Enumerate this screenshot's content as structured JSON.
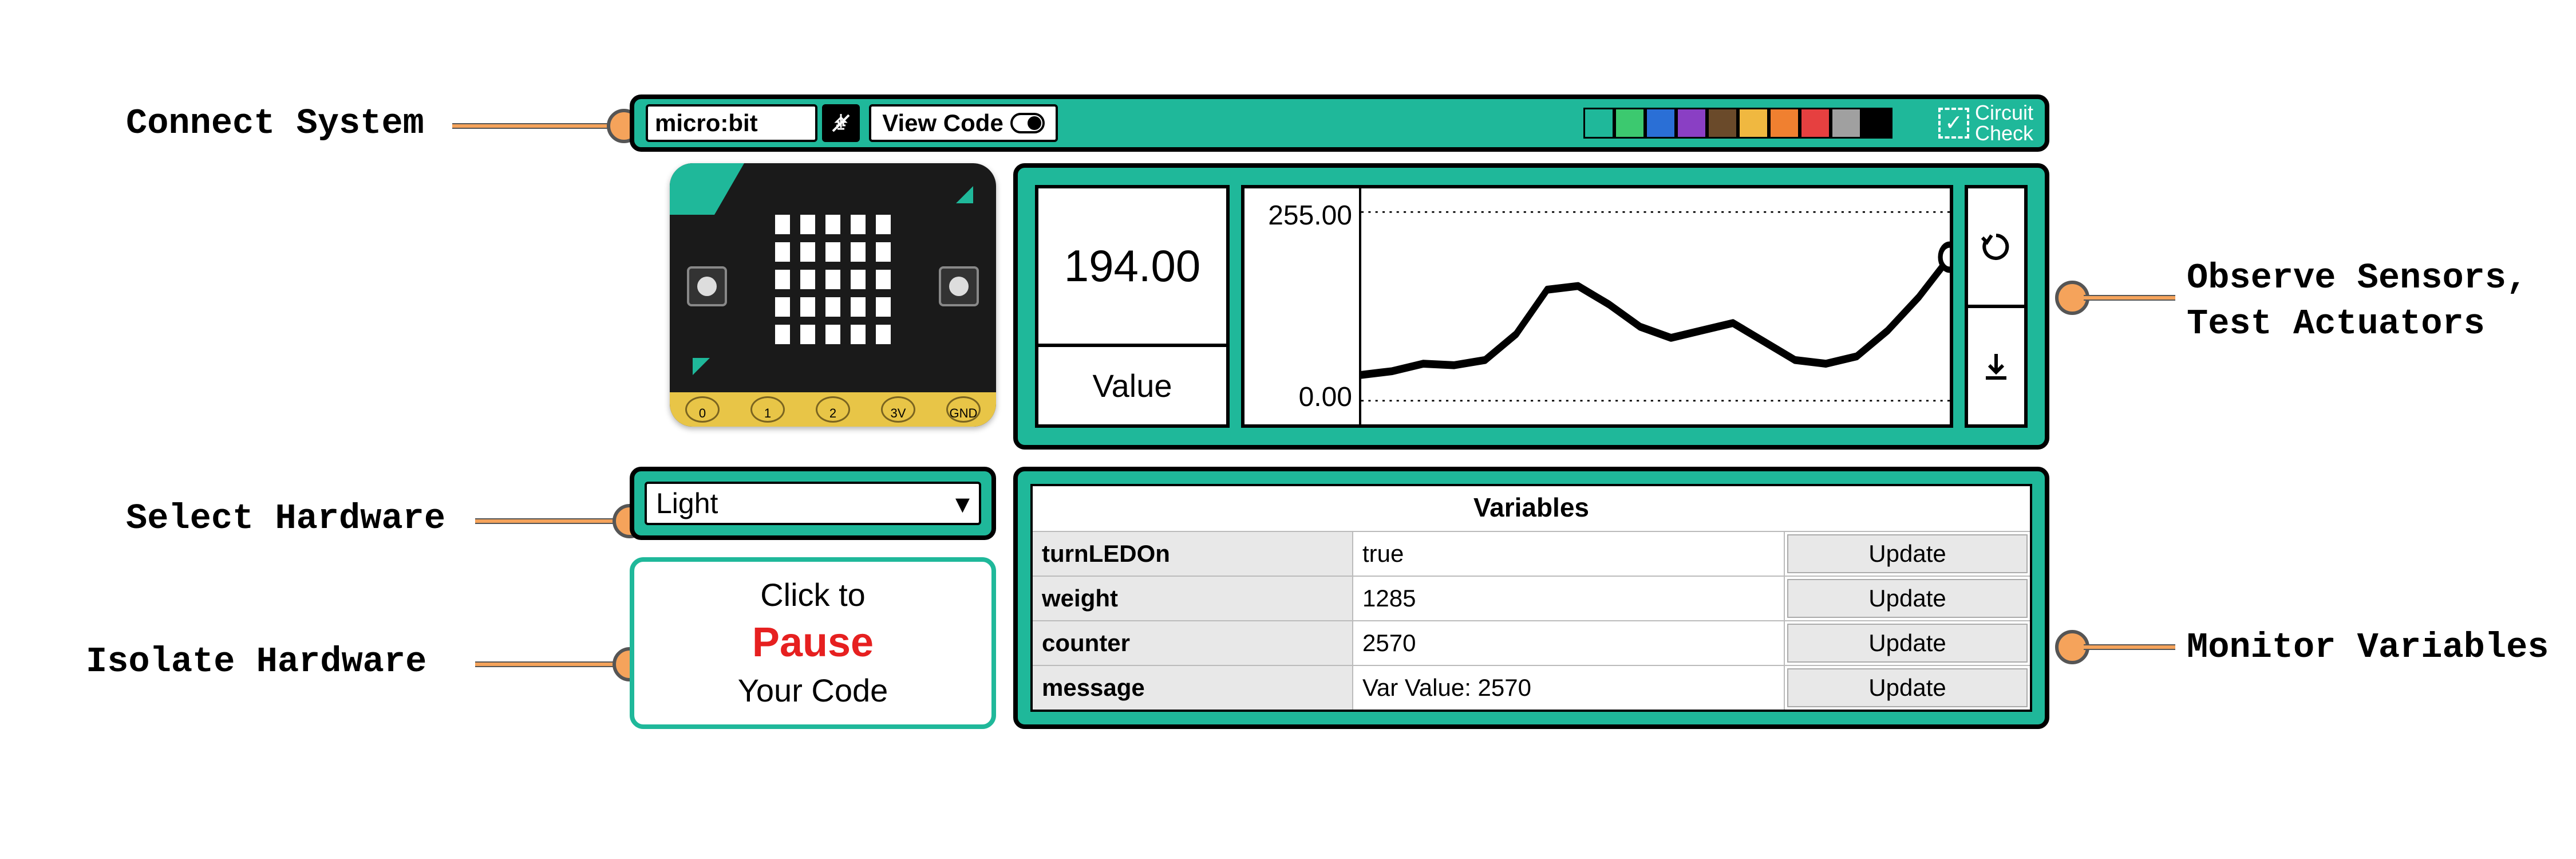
{
  "annotations": {
    "connect": "Connect System",
    "selectHw": "Select Hardware",
    "isolate": "Isolate Hardware",
    "observe1": "Observe Sensors,",
    "observe2": "Test Actuators",
    "monitor": "Monitor Variables"
  },
  "topbar": {
    "device": "micro:bit",
    "viewCode": "View Code",
    "palette": [
      "#1fb89a",
      "#3cc96f",
      "#2a6fd6",
      "#8a3fc4",
      "#6a4a2a",
      "#f0b840",
      "#f08030",
      "#e64040",
      "#a0a0a0",
      "#000000"
    ],
    "logo1": "Circuit",
    "logo2": "Check"
  },
  "board": {
    "pinLabels": [
      "0",
      "1",
      "2",
      "3V",
      "GND"
    ]
  },
  "sensor": {
    "value": "194.00",
    "label": "Value",
    "ymax": "255.00",
    "ymin": "0.00"
  },
  "hardware": {
    "selected": "Light"
  },
  "pause": {
    "line1": "Click to",
    "word": "Pause",
    "line2": "Your Code"
  },
  "variables": {
    "title": "Variables",
    "updateLabel": "Update",
    "rows": [
      {
        "name": "turnLEDOn",
        "value": "true"
      },
      {
        "name": "weight",
        "value": "1285"
      },
      {
        "name": "counter",
        "value": "2570"
      },
      {
        "name": "message",
        "value": "Var Value: 2570"
      }
    ]
  },
  "chart_data": {
    "type": "line",
    "title": "",
    "xlabel": "",
    "ylabel": "Value",
    "ylim": [
      0,
      255
    ],
    "current": 194.0,
    "x": [
      0,
      1,
      2,
      3,
      4,
      5,
      6,
      7,
      8,
      9,
      10,
      11,
      12,
      13,
      14,
      15,
      16,
      17,
      18,
      19
    ],
    "values": [
      35,
      40,
      50,
      48,
      55,
      90,
      150,
      155,
      130,
      100,
      85,
      95,
      105,
      80,
      55,
      50,
      60,
      95,
      140,
      194
    ]
  }
}
